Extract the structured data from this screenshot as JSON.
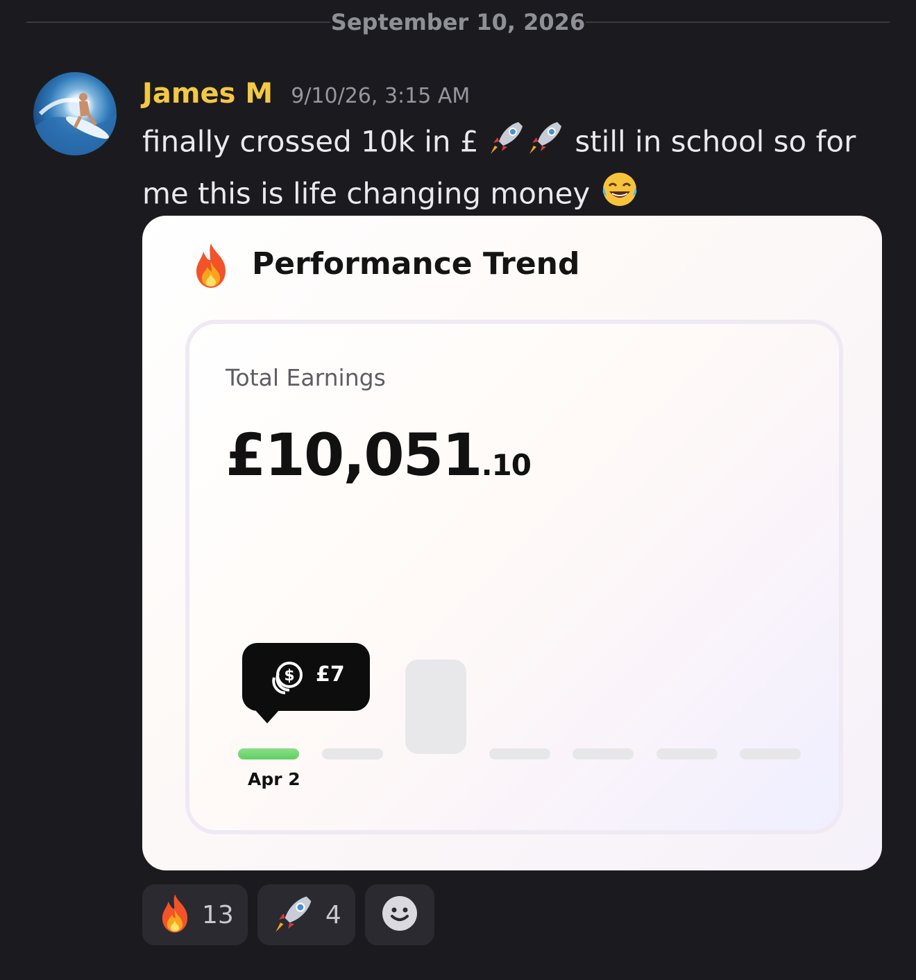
{
  "divider": {
    "date": "September 10, 2026"
  },
  "message": {
    "author": "James M",
    "timestamp": "9/10/26, 3:15 AM",
    "text_part1": "finally crossed 10k in £",
    "text_part2": "still in school so for me this is life changing money",
    "emojis": [
      "rocket-icon",
      "rocket-icon",
      "laughing-tears-icon"
    ]
  },
  "card": {
    "title": "Performance Trend",
    "title_icon": "fire-icon",
    "total_label": "Total Earnings",
    "amount_main": "£10,051",
    "amount_cents": ".10",
    "tooltip_value": "£7",
    "tooltip_icon": "coin-icon",
    "selected_label": "Apr 2"
  },
  "chart_data": {
    "type": "bar",
    "categories": [
      "Apr 2",
      "",
      "",
      "",
      "",
      "",
      ""
    ],
    "values": [
      7,
      0,
      null,
      0,
      0,
      0,
      0
    ],
    "highlighted_index": 0,
    "highlight_color": "#6fd66f"
  },
  "reactions": [
    {
      "icon": "fire-icon",
      "count": "13"
    },
    {
      "icon": "rocket-icon",
      "count": "4"
    }
  ],
  "add_reaction_icon": "smiley-icon"
}
